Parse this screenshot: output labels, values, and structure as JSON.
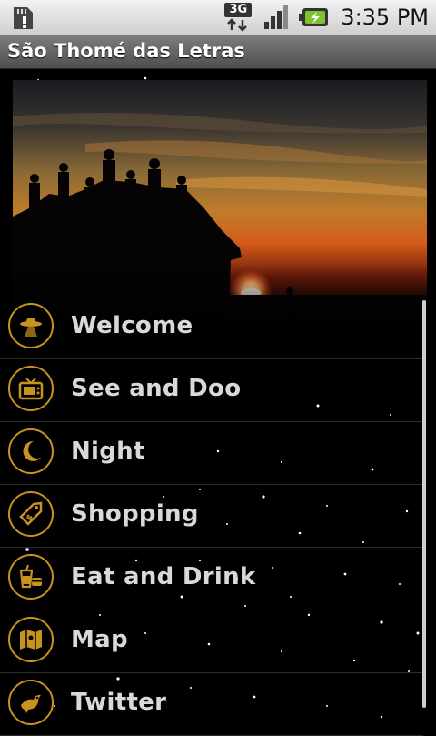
{
  "status_bar": {
    "time": "3:35 PM",
    "network": "3G",
    "icons": [
      "sd-card-alert-icon",
      "3g-data-icon",
      "signal-strength-icon",
      "battery-charging-icon"
    ]
  },
  "app": {
    "title": "São Thomé das Letras"
  },
  "menu": {
    "items": [
      {
        "label": "Welcome",
        "icon": "ufo-icon"
      },
      {
        "label": "See and Doo",
        "icon": "tv-icon"
      },
      {
        "label": "Night",
        "icon": "moon-icon"
      },
      {
        "label": "Shopping",
        "icon": "price-tag-icon"
      },
      {
        "label": "Eat and Drink",
        "icon": "drink-and-food-icon"
      },
      {
        "label": "Map",
        "icon": "map-icon"
      },
      {
        "label": "Twitter",
        "icon": "bird-icon"
      }
    ]
  },
  "colors": {
    "accent": "#c8921f",
    "label": "#d9d9d9",
    "background": "#000000"
  }
}
